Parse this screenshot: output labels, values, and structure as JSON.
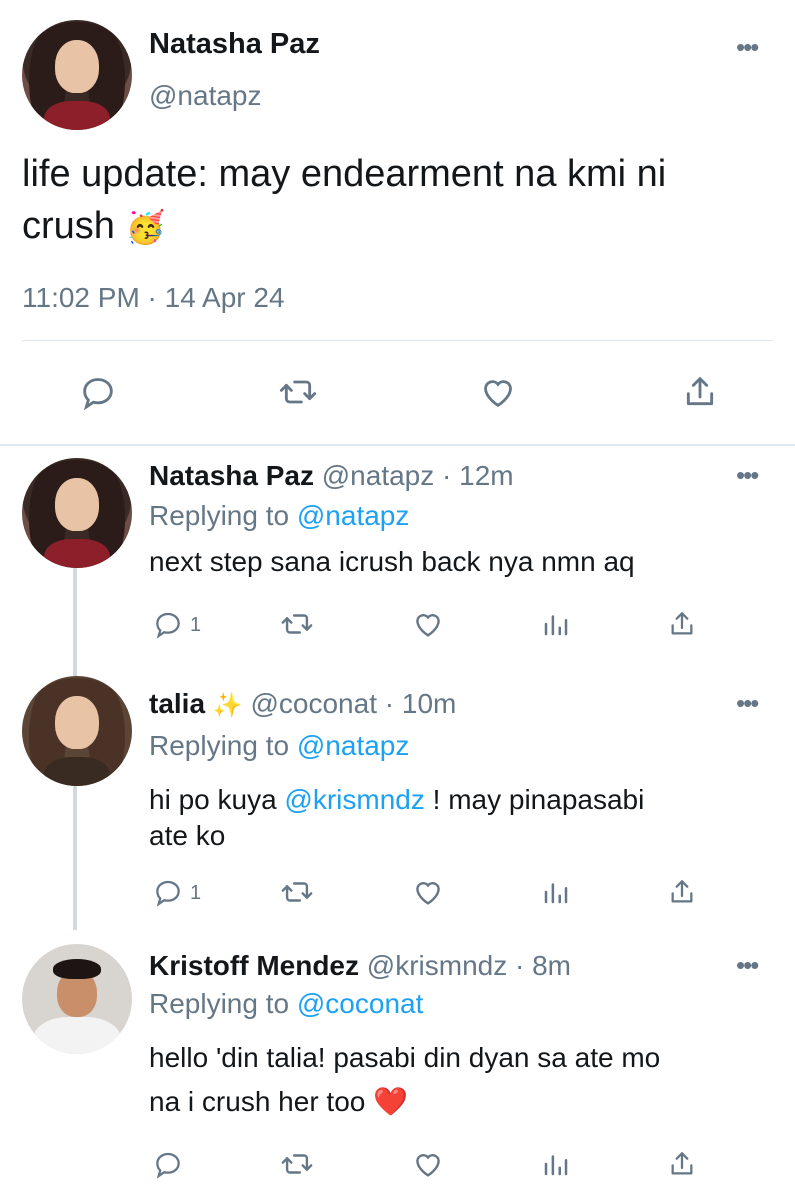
{
  "main_tweet": {
    "display_name": "Natasha Paz",
    "handle": "@natapz",
    "text_line1": "life update: may endearment na kmi ni",
    "text_line2": "crush",
    "emoji": "🥳",
    "timestamp": "11:02 PM · 14 Apr 24",
    "more_icon": "more-dots-icon"
  },
  "replies": [
    {
      "display_name": "Natasha Paz",
      "handle": "@natapz",
      "time": "· 12m",
      "replying_prefix": "Replying to",
      "replying_handle": "@natapz",
      "text": "next step sana icrush back nya nmn aq",
      "reply_count": "1"
    },
    {
      "display_name": "talia",
      "name_emoji": "✨",
      "handle": "@coconat",
      "time": "· 10m",
      "replying_prefix": "Replying to",
      "replying_handle": "@natapz",
      "text_part1": "hi po kuya",
      "text_mention": "@krismndz",
      "text_part2": "! may pinapasabi",
      "text_line2": "ate ko",
      "reply_count": "1"
    },
    {
      "display_name": "Kristoff Mendez",
      "handle": "@krismndz",
      "time": "· 8m",
      "replying_prefix": "Replying to",
      "replying_handle": "@coconat",
      "text_line1": "hello 'din talia! pasabi din dyan sa ate mo",
      "text_line2": "na i crush her too",
      "text_emoji": "❤️",
      "reply_count": ""
    }
  ],
  "colors": {
    "link": "#1da1f2",
    "muted": "#657786",
    "text": "#14171a",
    "divider": "#e1e8ed"
  }
}
